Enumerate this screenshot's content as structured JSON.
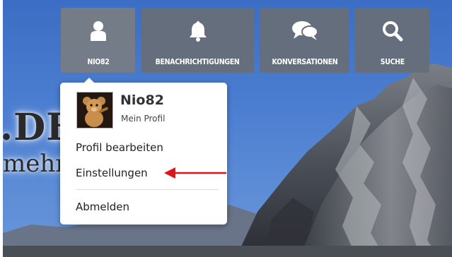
{
  "brand": {
    "title": ".DE",
    "tagline": "mehr"
  },
  "nav": {
    "items": [
      {
        "label": "NIO82",
        "icon": "user-icon"
      },
      {
        "label": "BENACHRICHTIGUNGEN",
        "icon": "bell-icon"
      },
      {
        "label": "KONVERSATIONEN",
        "icon": "chat-bubbles-icon"
      },
      {
        "label": "SUCHE",
        "icon": "search-icon"
      }
    ]
  },
  "user_menu": {
    "username": "Nio82",
    "profile_link": "Mein Profil",
    "items": [
      {
        "label": "Profil bearbeiten"
      },
      {
        "label": "Einstellungen"
      },
      {
        "label": "Abmelden"
      }
    ]
  },
  "colors": {
    "nav_bg": "#686e76",
    "annotation_arrow": "#e0121b",
    "sky": "#4b7dd0"
  }
}
